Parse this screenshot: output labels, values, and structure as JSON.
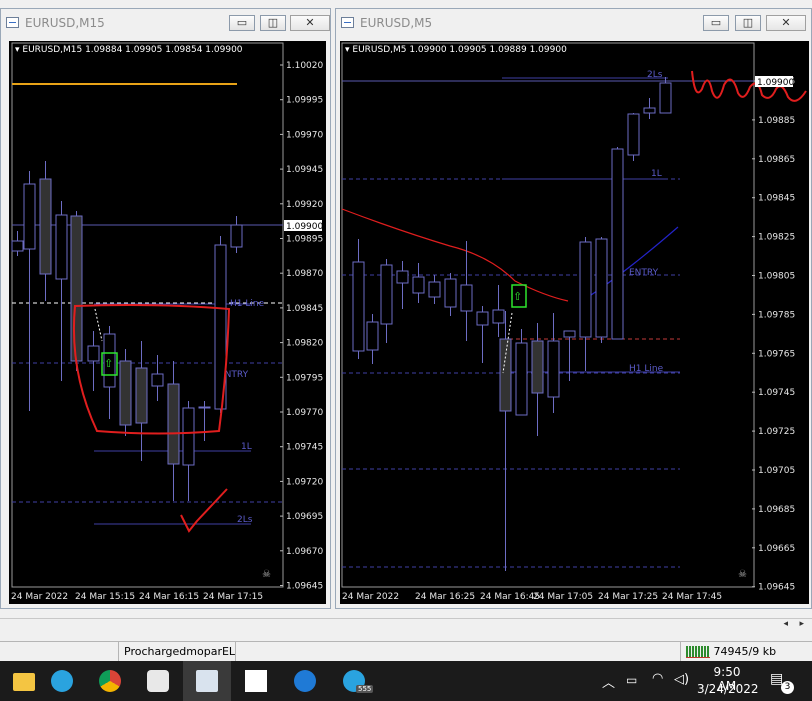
{
  "chart1": {
    "window_title": "EURUSD,M15",
    "header": "▾ EURUSD,M15  1.09884 1.09905 1.09854 1.09900",
    "price_labels": [
      "1.10020",
      "1.09995",
      "1.09970",
      "1.09945",
      "1.09920",
      "1.09895",
      "1.09870",
      "1.09845",
      "1.09820",
      "1.09795",
      "1.09770",
      "1.09745",
      "1.09720",
      "1.09695",
      "1.09670",
      "1.09645"
    ],
    "current_price": "1.09900",
    "time_labels": [
      "24 Mar 2022",
      "24 Mar 15:15",
      "24 Mar 16:15",
      "24 Mar 17:15"
    ],
    "line_labels": {
      "h1": "H1 Line",
      "entry": "ENTRY",
      "l1": "1L",
      "l2": "2Ls"
    }
  },
  "chart2": {
    "window_title": "EURUSD,M5",
    "header": "▾ EURUSD,M5  1.09900 1.09905 1.09889 1.09900",
    "price_labels": [
      "1.09905",
      "1.09885",
      "1.09865",
      "1.09845",
      "1.09825",
      "1.09805",
      "1.09785",
      "1.09765",
      "1.09745",
      "1.09725",
      "1.09705",
      "1.09685",
      "1.09665",
      "1.09645"
    ],
    "current_price": "1.09900",
    "time_labels": [
      "24 Mar 2022",
      "24 Mar 16:25",
      "24 Mar 16:45",
      "24 Mar 17:05",
      "24 Mar 17:25",
      "24 Mar 17:45"
    ],
    "line_labels": {
      "l2": "2Ls",
      "l1": "1L",
      "entry": "ENTRY",
      "h1": "H1 Line"
    }
  },
  "window_buttons": {
    "minimize": "▭",
    "maximize": "◫",
    "close": "✕"
  },
  "status_bar": {
    "profile": "ProchargedmoparEL",
    "traffic": "74945/9 kb"
  },
  "tray": {
    "time": "9:50 AM",
    "date": "3/24/2022",
    "notifications": "3",
    "telegram_badge": "555"
  },
  "taskbar_apps": [
    "file-explorer",
    "telegram",
    "chrome",
    "snipping",
    "terminal",
    "notes",
    "edge",
    "telegram-2"
  ],
  "colors": {
    "candle_border": "#6d6dc4",
    "candle_fill": "#333333",
    "guide": "#3f3fa3",
    "red": "#e01e1e",
    "gold": "#e8a317"
  }
}
